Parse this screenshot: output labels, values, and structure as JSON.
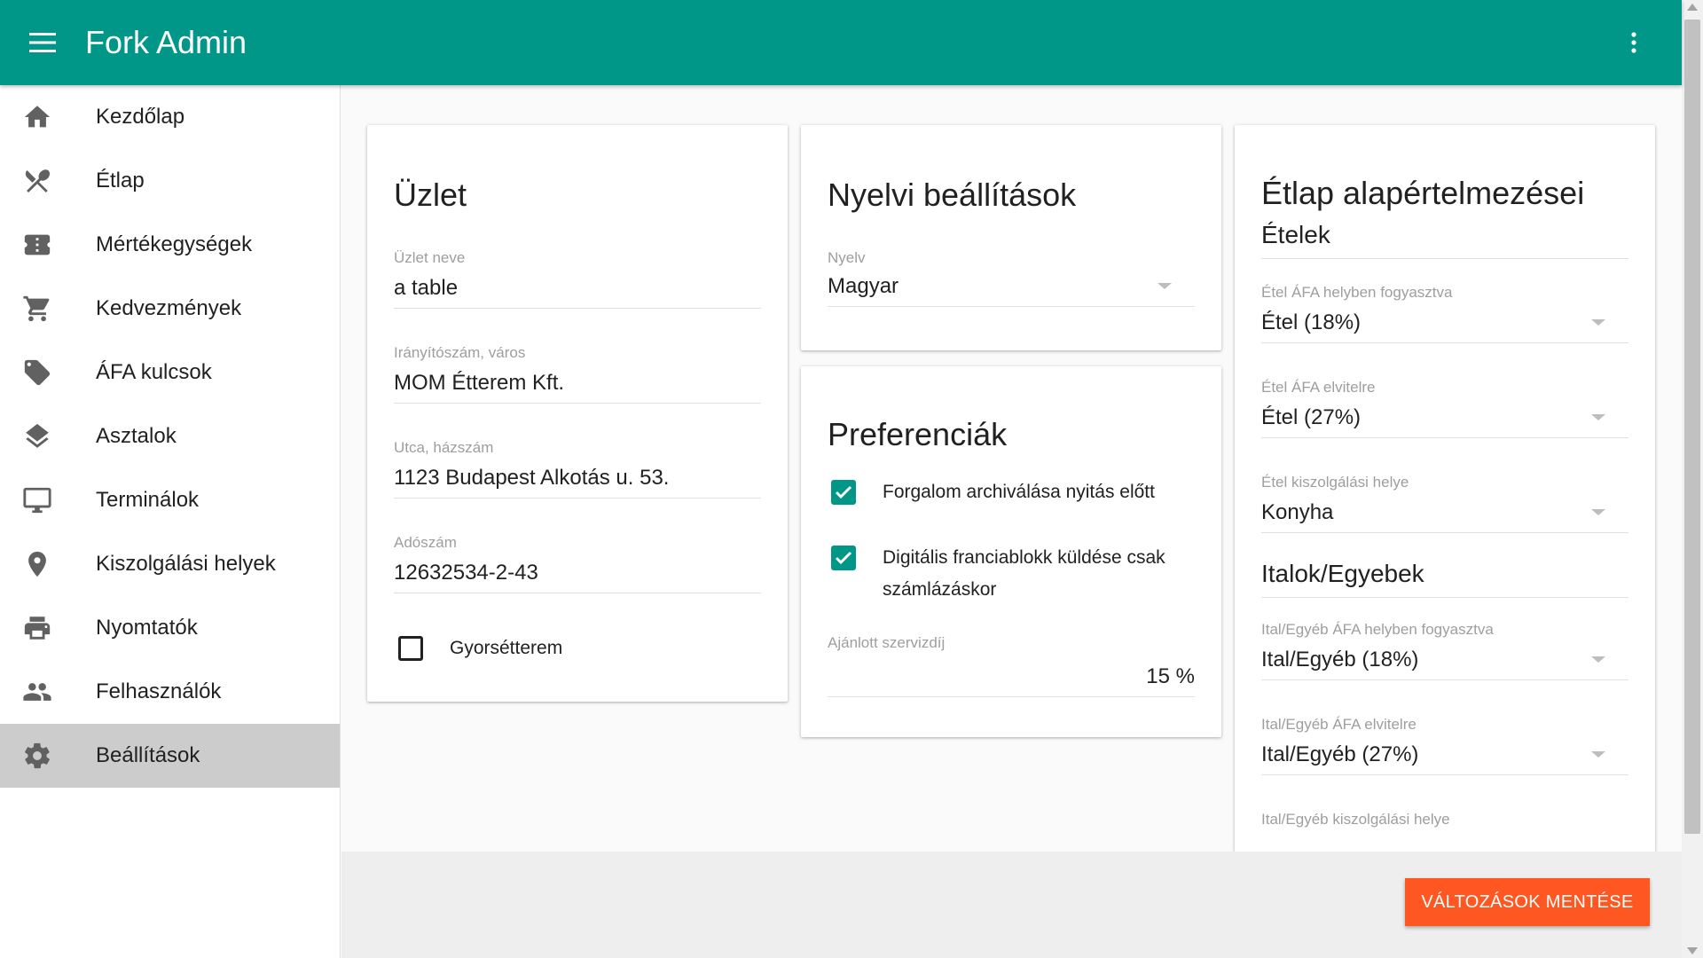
{
  "app": {
    "title": "Fork Admin"
  },
  "sidebar": {
    "items": [
      {
        "label": "Kezdőlap",
        "icon": "home-icon"
      },
      {
        "label": "Étlap",
        "icon": "utensils-icon"
      },
      {
        "label": "Mértékegységek",
        "icon": "ticket-icon"
      },
      {
        "label": "Kedvezmények",
        "icon": "cart-icon"
      },
      {
        "label": "ÁFA kulcsok",
        "icon": "tag-icon"
      },
      {
        "label": "Asztalok",
        "icon": "layers-icon"
      },
      {
        "label": "Terminálok",
        "icon": "monitor-icon"
      },
      {
        "label": "Kiszolgálási helyek",
        "icon": "location-pin-icon"
      },
      {
        "label": "Nyomtatók",
        "icon": "printer-icon"
      },
      {
        "label": "Felhasználók",
        "icon": "people-icon"
      },
      {
        "label": "Beállítások",
        "icon": "gear-icon",
        "active": true
      }
    ]
  },
  "business": {
    "title": "Üzlet",
    "name_label": "Üzlet neve",
    "name_value": "a table",
    "zip_label": "Irányítószám, város",
    "zip_value": "MOM Étterem Kft.",
    "street_label": "Utca, házszám",
    "street_value": "1123 Budapest Alkotás u. 53.",
    "tax_label": "Adószám",
    "tax_value": "12632534-2-43",
    "fastfood_label": "Gyorsétterem",
    "fastfood_checked": false
  },
  "language": {
    "title": "Nyelvi beállítások",
    "lang_label": "Nyelv",
    "lang_value": "Magyar"
  },
  "preferences": {
    "title": "Preferenciák",
    "archive_label": "Forgalom archiválása nyitás előtt",
    "archive_checked": true,
    "digital_label": "Digitális franciablokk küldése csak számlázáskor",
    "digital_checked": true,
    "service_label": "Ajánlott szervizdíj",
    "service_value": "15 %"
  },
  "menu_defaults": {
    "title": "Étlap alapértelmezései",
    "food_section": "Ételek",
    "food_vat_dine_label": "Étel ÁFA helyben fogyasztva",
    "food_vat_dine_value": "Étel (18%)",
    "food_vat_take_label": "Étel ÁFA elvitelre",
    "food_vat_take_value": "Étel (27%)",
    "food_place_label": "Étel kiszolgálási helye",
    "food_place_value": "Konyha",
    "drink_section": "Italok/Egyebek",
    "drink_vat_dine_label": "Ital/Egyéb ÁFA helyben fogyasztva",
    "drink_vat_dine_value": "Ital/Egyéb (18%)",
    "drink_vat_take_label": "Ital/Egyéb ÁFA elvitelre",
    "drink_vat_take_value": "Ital/Egyéb (27%)",
    "drink_place_label": "Ital/Egyéb kiszolgálási helye"
  },
  "footer": {
    "save_label": "VÁLTOZÁSOK MENTÉSE"
  },
  "colors": {
    "primary": "#009688",
    "accent": "#ff5722",
    "active_nav": "#cccccc"
  }
}
